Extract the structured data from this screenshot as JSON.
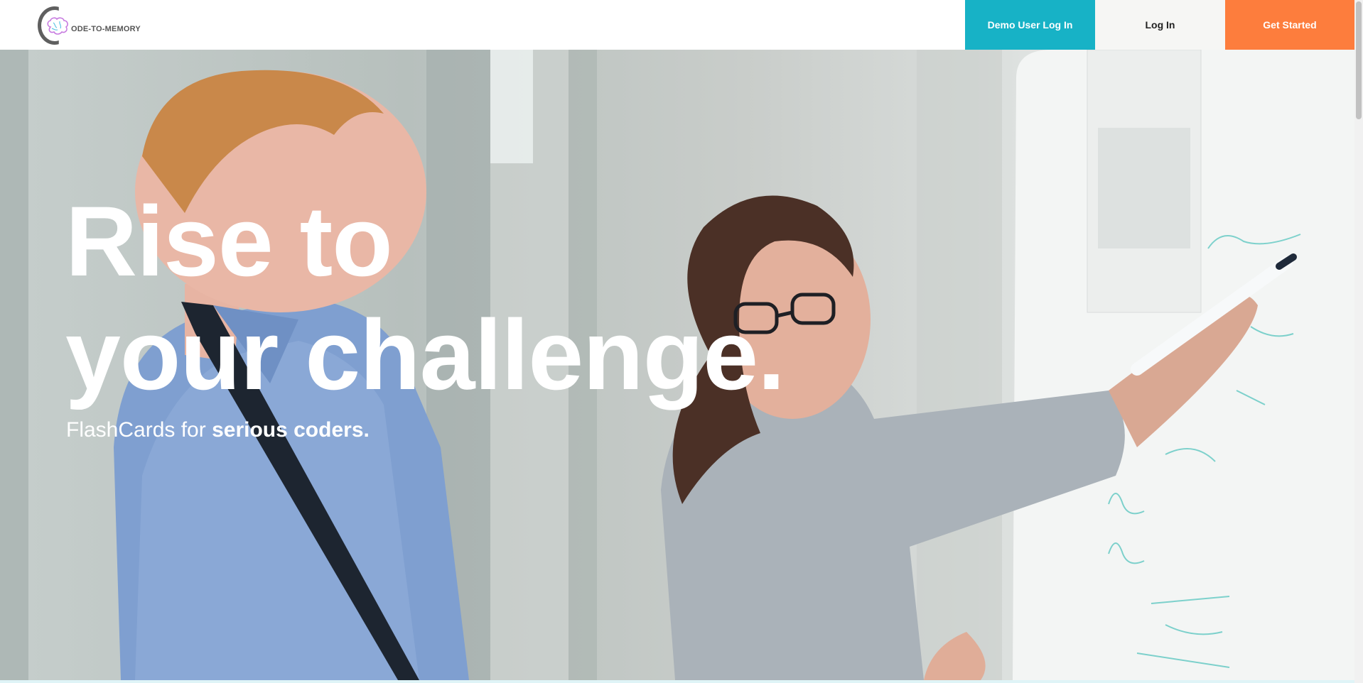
{
  "logo": {
    "text": "ODE-TO-MEMORY",
    "icon": "brain-icon"
  },
  "nav": {
    "demo_label": "Demo User Log In",
    "login_label": "Log In",
    "start_label": "Get Started"
  },
  "hero": {
    "headline_line1": "Rise to",
    "headline_line2": "your challenge.",
    "sub_regular": "FlashCards for ",
    "sub_bold": "serious coders."
  },
  "colors": {
    "demo_button": "#17b2c6",
    "login_button": "#f6f6f4",
    "start_button": "#fd7d3d"
  }
}
